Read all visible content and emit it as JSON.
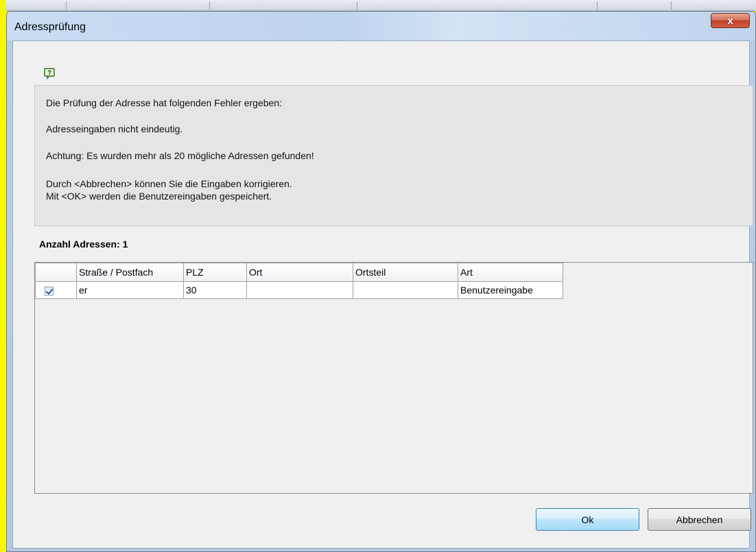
{
  "dialog": {
    "title": "Adressprüfung",
    "close_label": "x",
    "help_icon": "question-bubble-icon"
  },
  "message": {
    "line1": "Die Prüfung der Adresse hat folgenden Fehler ergeben:",
    "line2": "Adresseingaben nicht eindeutig.",
    "line3": "Achtung: Es wurden mehr als 20 mögliche Adressen gefunden!",
    "line4": "Durch <Abbrechen> können Sie die Eingaben korrigieren.",
    "line5": "Mit <OK> werden die Benutzereingaben gespeichert."
  },
  "count_label": "Anzahl Adressen: 1",
  "table": {
    "headers": [
      "",
      "Straße / Postfach",
      "PLZ",
      "Ort",
      "Ortsteil",
      "Art"
    ],
    "rows": [
      {
        "checked": true,
        "strasse": "er",
        "plz": "30",
        "ort": "",
        "ortsteil": "",
        "art": "Benutzereingabe"
      }
    ]
  },
  "buttons": {
    "ok": "Ok",
    "cancel": "Abbrechen"
  },
  "colors": {
    "highlight": "#f7f700",
    "close_button": "#c0412a",
    "ok_button_border": "#3c7fb1"
  }
}
